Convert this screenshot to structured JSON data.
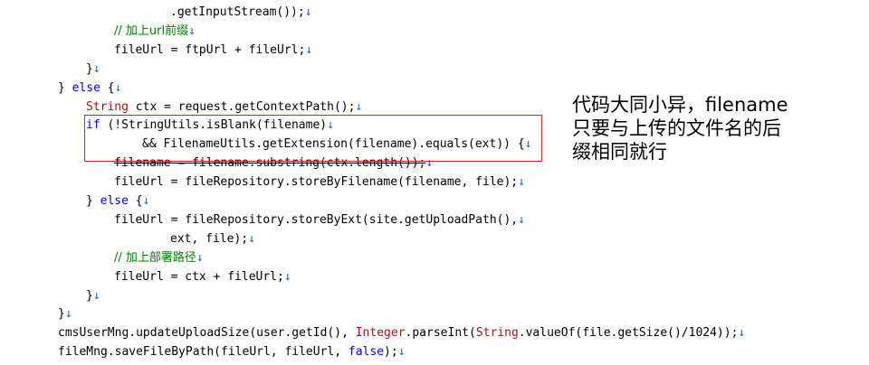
{
  "code_lines": [
    {
      "indent": 188,
      "segments": [
        {
          "t": ".getInputStream());",
          "c": "plain"
        },
        {
          "t": "↓",
          "c": "mark"
        }
      ]
    },
    {
      "indent": 126,
      "segments": [
        {
          "t": "// 加上url前缀",
          "c": "green"
        },
        {
          "t": "↓",
          "c": "mark"
        }
      ]
    },
    {
      "indent": 126,
      "segments": [
        {
          "t": "fileUrl = ftpUrl + fileUrl;",
          "c": "plain"
        },
        {
          "t": "↓",
          "c": "mark"
        }
      ]
    },
    {
      "indent": 95,
      "segments": [
        {
          "t": "}",
          "c": "plain"
        },
        {
          "t": "↓",
          "c": "mark"
        }
      ]
    },
    {
      "indent": 64,
      "segments": [
        {
          "t": "} ",
          "c": "plain"
        },
        {
          "t": "else",
          "c": "blue"
        },
        {
          "t": " {",
          "c": "plain"
        },
        {
          "t": "↓",
          "c": "mark"
        }
      ]
    },
    {
      "indent": 95,
      "segments": [
        {
          "t": "String",
          "c": "red"
        },
        {
          "t": " ctx = request.getContextPath();",
          "c": "plain"
        },
        {
          "t": "↓",
          "c": "mark"
        }
      ]
    },
    {
      "indent": 95,
      "segments": [
        {
          "t": "if",
          "c": "blue"
        },
        {
          "t": " (!StringUtils.isBlank(filename)",
          "c": "plain"
        },
        {
          "t": "↓",
          "c": "mark"
        }
      ]
    },
    {
      "indent": 157,
      "segments": [
        {
          "t": "&& FilenameUtils.getExtension(filename).equals(ext)) {",
          "c": "plain"
        },
        {
          "t": "↓",
          "c": "mark"
        }
      ]
    },
    {
      "indent": 126,
      "segments": [
        {
          "t": "filename = filename.substring(ctx.length());",
          "c": "strike"
        },
        {
          "t": "↓",
          "c": "mark"
        }
      ]
    },
    {
      "indent": 126,
      "segments": [
        {
          "t": "fileUrl = fileRepository.storeByFilename(filename, file);",
          "c": "plain"
        },
        {
          "t": "↓",
          "c": "mark"
        }
      ]
    },
    {
      "indent": 95,
      "segments": [
        {
          "t": "} ",
          "c": "plain"
        },
        {
          "t": "else",
          "c": "blue"
        },
        {
          "t": " {",
          "c": "plain"
        },
        {
          "t": "↓",
          "c": "mark"
        }
      ]
    },
    {
      "indent": 126,
      "segments": [
        {
          "t": "fileUrl = fileRepository.storeByExt(site.getUploadPath(),",
          "c": "plain"
        },
        {
          "t": "↓",
          "c": "mark"
        }
      ]
    },
    {
      "indent": 188,
      "segments": [
        {
          "t": "ext, file);",
          "c": "plain"
        },
        {
          "t": "↓",
          "c": "mark"
        }
      ]
    },
    {
      "indent": 126,
      "segments": [
        {
          "t": "// 加上部署路径",
          "c": "green"
        },
        {
          "t": "↓",
          "c": "mark"
        }
      ]
    },
    {
      "indent": 126,
      "segments": [
        {
          "t": "fileUrl = ctx + fileUrl;",
          "c": "plain"
        },
        {
          "t": "↓",
          "c": "mark"
        }
      ]
    },
    {
      "indent": 95,
      "segments": [
        {
          "t": "}",
          "c": "plain"
        },
        {
          "t": "↓",
          "c": "mark"
        }
      ]
    },
    {
      "indent": 64,
      "segments": [
        {
          "t": "}",
          "c": "plain"
        },
        {
          "t": "↓",
          "c": "mark"
        }
      ]
    },
    {
      "indent": 64,
      "segments": [
        {
          "t": "cmsUserMng.updateUploadSize(user.getId(), ",
          "c": "plain"
        },
        {
          "t": "Integer",
          "c": "red"
        },
        {
          "t": ".parseInt(",
          "c": "plain"
        },
        {
          "t": "String",
          "c": "red"
        },
        {
          "t": ".valueOf(file.getSize()/1024));",
          "c": "plain"
        },
        {
          "t": "↓",
          "c": "mark"
        }
      ]
    },
    {
      "indent": 64,
      "segments": [
        {
          "t": "fileMng.saveFileByPath(fileUrl, fileUrl, ",
          "c": "plain"
        },
        {
          "t": "false",
          "c": "blue"
        },
        {
          "t": ");",
          "c": "plain"
        },
        {
          "t": "↓",
          "c": "mark"
        }
      ]
    }
  ],
  "annotation": {
    "lines": [
      "代码大同小异，filename",
      "只要与上传的文件名的后",
      "缀相同就行"
    ]
  }
}
